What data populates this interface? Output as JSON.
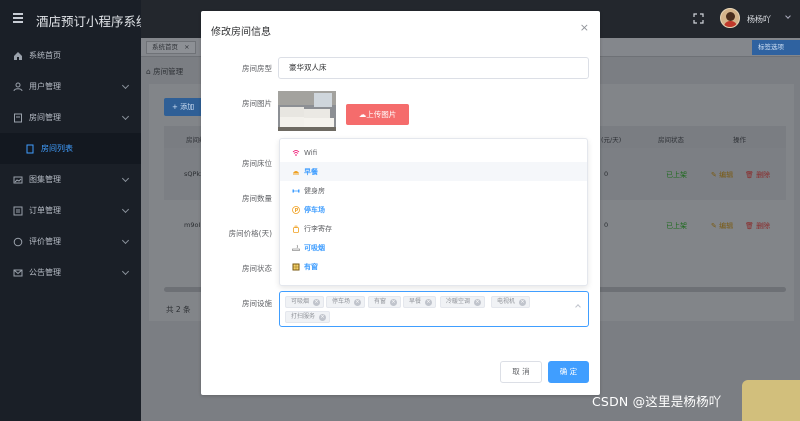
{
  "app": {
    "title": "酒店预订小程序系统"
  },
  "sidebar": {
    "items": [
      {
        "label": "系统首页",
        "icon": "home-icon",
        "has_children": false
      },
      {
        "label": "用户管理",
        "icon": "user-icon",
        "has_children": true
      },
      {
        "label": "房间管理",
        "icon": "room-icon",
        "has_children": true
      },
      {
        "label": "房间列表",
        "icon": "doc-icon",
        "has_children": false,
        "active": true
      },
      {
        "label": "图集管理",
        "icon": "image-icon",
        "has_children": true
      },
      {
        "label": "订单管理",
        "icon": "order-icon",
        "has_children": true
      },
      {
        "label": "评价管理",
        "icon": "comment-icon",
        "has_children": true
      },
      {
        "label": "公告管理",
        "icon": "mail-icon",
        "has_children": true
      }
    ]
  },
  "header": {
    "user_name": "杨杨吖"
  },
  "tabs": {
    "home": "系统首页",
    "close": "×",
    "options": "标签选项"
  },
  "breadcrumb": "房间管理",
  "table": {
    "add_button": "添加",
    "columns": [
      "房间编号",
      "(元/天)",
      "房间状态",
      "操作"
    ],
    "rows": [
      {
        "id": "sQPkxi",
        "price": "0",
        "status": "已上架",
        "edit": "编辑",
        "delete": "删除"
      },
      {
        "id": "m9oIEc",
        "price": "0",
        "status": "已上架",
        "edit": "编辑",
        "delete": "删除"
      }
    ],
    "total": "共 2 条"
  },
  "dialog": {
    "title": "修改房间信息",
    "close": "×",
    "labels": {
      "type": "房间房型",
      "image": "房间图片",
      "bed": "房间床位",
      "count": "房间数量",
      "price": "房间价格(天)",
      "status": "房间状态",
      "facilities": "房间设施"
    },
    "type_value": "豪华双人床",
    "upload_button": "上传图片",
    "dropdown_options": [
      {
        "label": "Wifi",
        "icon": "wifi-icon",
        "selected": false
      },
      {
        "label": "早餐",
        "icon": "breakfast-icon",
        "selected": true
      },
      {
        "label": "健身房",
        "icon": "dumbbell-icon",
        "selected": false
      },
      {
        "label": "停车场",
        "icon": "parking-icon",
        "selected": true
      },
      {
        "label": "行李寄存",
        "icon": "luggage-icon",
        "selected": false
      },
      {
        "label": "可吸烟",
        "icon": "smoking-icon",
        "selected": true
      },
      {
        "label": "有窗",
        "icon": "window-icon",
        "selected": true
      }
    ],
    "tags": [
      "可吸烟",
      "停车场",
      "有窗",
      "早餐",
      "冷暖空调",
      "电视机",
      "打扫服务"
    ],
    "cancel": "取 消",
    "confirm": "确 定"
  },
  "watermark": "CSDN @这里是杨杨吖",
  "colors": {
    "primary": "#409eff",
    "danger": "#f56c6c",
    "sidebar": "#1a1f27"
  }
}
